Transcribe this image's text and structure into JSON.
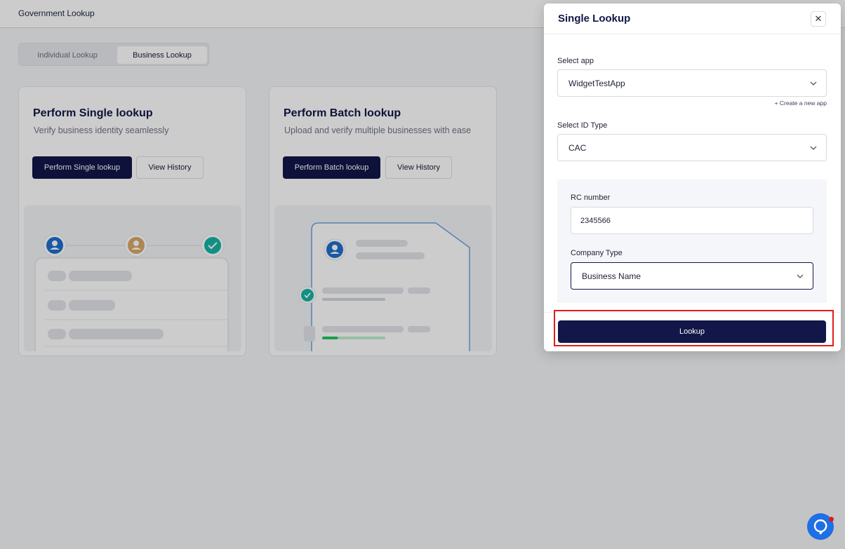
{
  "topbar": {
    "title": "Government Lookup"
  },
  "tabs": [
    {
      "label": "Individual Lookup",
      "active": false
    },
    {
      "label": "Business Lookup",
      "active": true
    }
  ],
  "cards": {
    "single": {
      "title": "Perform Single lookup",
      "subtitle": "Verify business identity seamlessly",
      "primary_label": "Perform Single lookup",
      "secondary_label": "View History"
    },
    "batch": {
      "title": "Perform Batch lookup",
      "subtitle": "Upload and verify multiple businesses with ease",
      "primary_label": "Perform Batch lookup",
      "secondary_label": "View History",
      "upload_progress": 0.25
    }
  },
  "modal": {
    "title": "Single Lookup",
    "close_icon": "close-icon",
    "app_label": "Select app",
    "app_value": "WidgetTestApp",
    "create_link": "+ Create a new app",
    "id_type_label": "Select ID Type",
    "id_type_value": "CAC",
    "rc_label": "RC number",
    "rc_value": "2345566",
    "company_type_label": "Company Type",
    "company_type_value": "Business Name",
    "lookup_label": "Lookup"
  },
  "colors": {
    "primary": "#121648",
    "highlight": "#e21b1b",
    "chat": "#1f6fe5",
    "success": "#22c55e"
  }
}
